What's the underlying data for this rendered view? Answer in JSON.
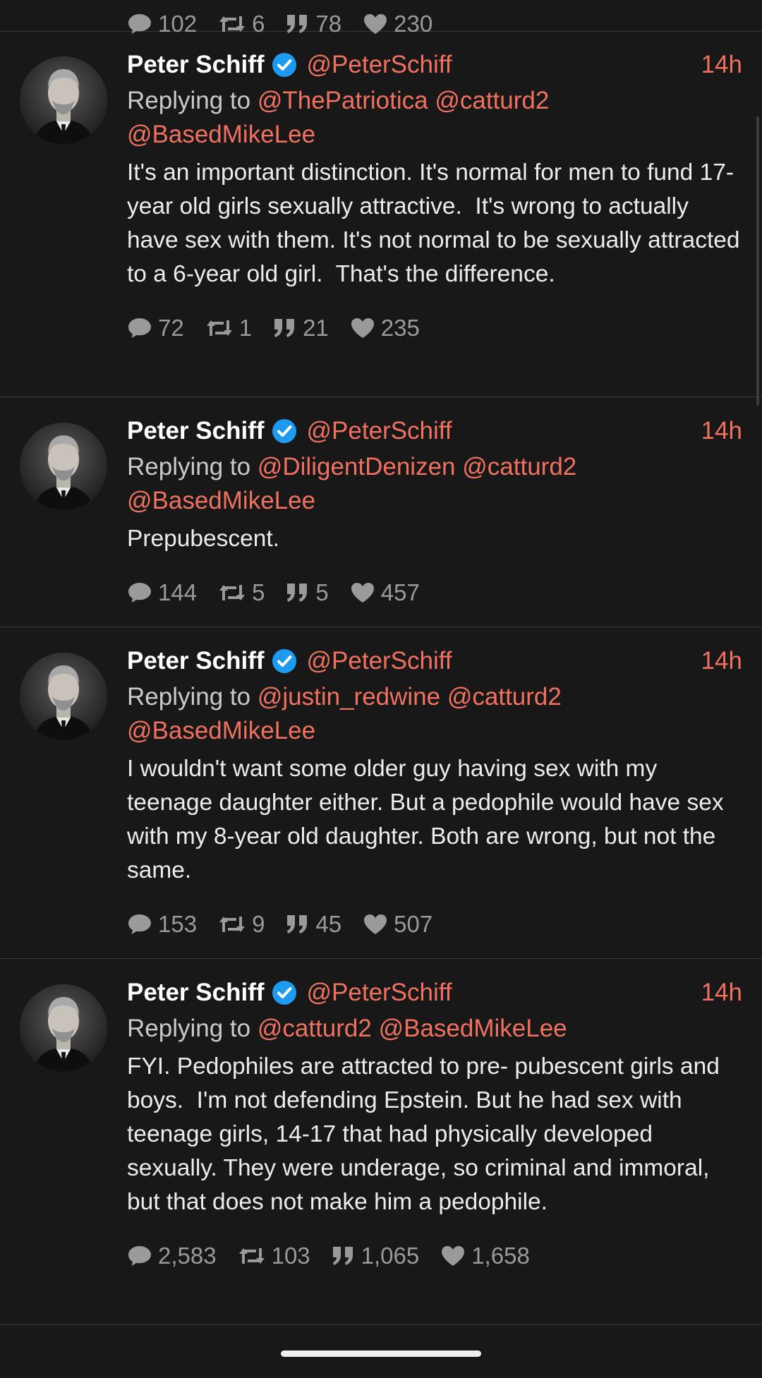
{
  "top_partial": {
    "replies": "102",
    "retweets": "6",
    "quotes": "78",
    "likes": "230"
  },
  "tweets": [
    {
      "name": "Peter Schiff",
      "handle": "@PeterSchiff",
      "time": "14h",
      "replying_label": "Replying to",
      "mentions": [
        "@ThePatriotica",
        "@catturd2",
        "@BasedMikeLee"
      ],
      "text": "It's an important distinction. It's normal for men to fund 17-year old girls sexually attractive.  It's wrong to actually have sex with them. It's not normal to be sexually attracted to a 6-year old girl.  That's the difference.",
      "replies": "72",
      "retweets": "1",
      "quotes": "21",
      "likes": "235"
    },
    {
      "name": "Peter Schiff",
      "handle": "@PeterSchiff",
      "time": "14h",
      "replying_label": "Replying to",
      "mentions": [
        "@DiligentDenizen",
        "@catturd2",
        "@BasedMikeLee"
      ],
      "text": "Prepubescent.",
      "replies": "144",
      "retweets": "5",
      "quotes": "5",
      "likes": "457"
    },
    {
      "name": "Peter Schiff",
      "handle": "@PeterSchiff",
      "time": "14h",
      "replying_label": "Replying to",
      "mentions": [
        "@justin_redwine",
        "@catturd2",
        "@BasedMikeLee"
      ],
      "text": "I wouldn't want some older guy having sex with my teenage daughter either. But a pedophile would have sex with my 8-year old daughter. Both are wrong, but not the same.",
      "replies": "153",
      "retweets": "9",
      "quotes": "45",
      "likes": "507"
    },
    {
      "name": "Peter Schiff",
      "handle": "@PeterSchiff",
      "time": "14h",
      "replying_label": "Replying to",
      "mentions": [
        "@catturd2",
        "@BasedMikeLee"
      ],
      "text": "FYI. Pedophiles are attracted to pre- pubescent girls and boys.  I'm not defending Epstein. But he had sex with teenage girls, 14-17 that had physically developed sexually. They were underage, so criminal and immoral, but that does not make him a pedophile.",
      "replies": "2,583",
      "retweets": "103",
      "quotes": "1,065",
      "likes": "1,658"
    }
  ],
  "colors": {
    "background": "#181818",
    "accent": "#f0715f",
    "verified": "#1d9bf0",
    "stat": "#9a9a9a"
  }
}
